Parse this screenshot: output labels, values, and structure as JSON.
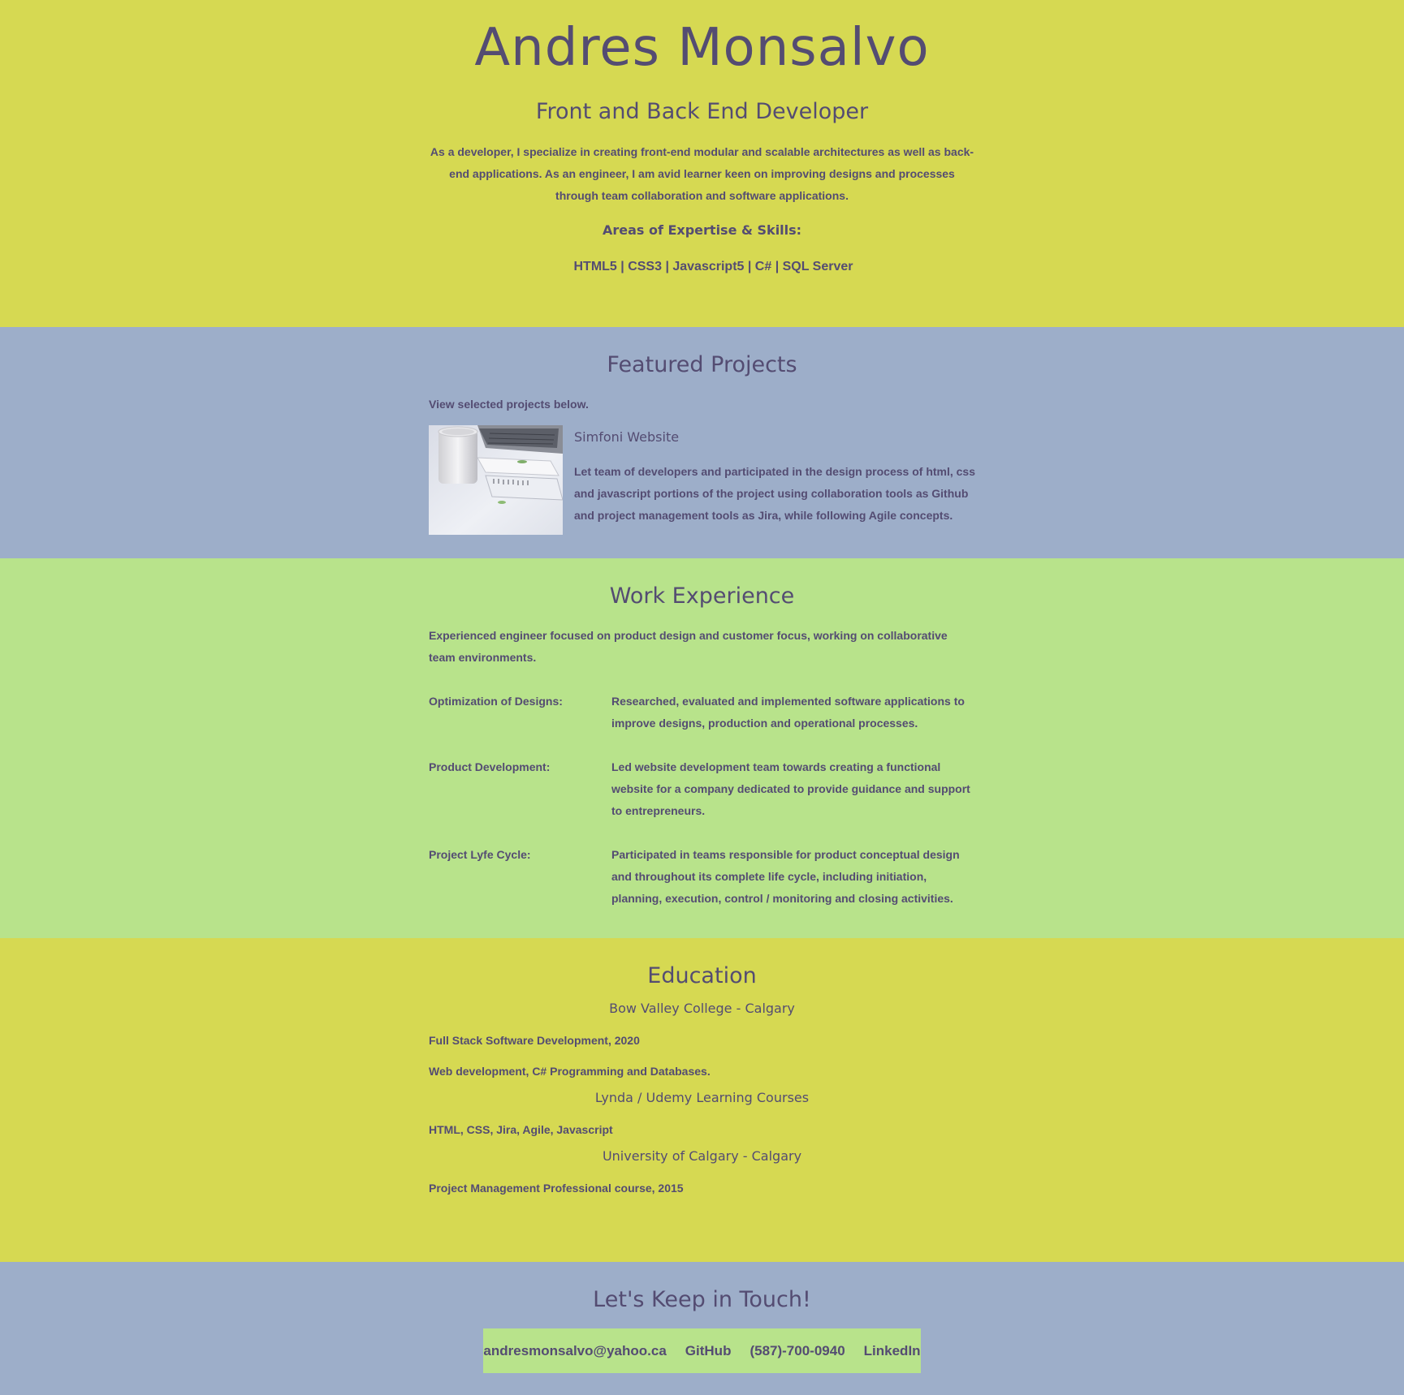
{
  "header": {
    "name": "Andres Monsalvo",
    "role": "Front and Back End Developer",
    "intro": "As a developer, I specialize in creating front-end modular and scalable architectures as well as back-end applications. As an engineer, I am avid learner keen on improving designs and processes through team collaboration and software applications.",
    "skills_heading": "Areas of Expertise & Skills:",
    "skills": "HTML5 | CSS3 | Javascript5 | C# | SQL Server"
  },
  "projects": {
    "title": "Featured Projects",
    "lead": "View selected projects below.",
    "items": [
      {
        "name": "Simfoni Website",
        "description": "Let team of developers and participated in the design process of html, css and javascript portions of the project using collaboration tools as Github and project management tools as Jira, while following Agile concepts."
      }
    ]
  },
  "work": {
    "title": "Work Experience",
    "lead": "Experienced engineer focused on product design and customer focus, working on collaborative team environments.",
    "items": [
      {
        "label": "Optimization of Designs:",
        "text": "Researched, evaluated and implemented software applications to improve designs, production and operational processes."
      },
      {
        "label": "Product Development:",
        "text": "Led website development team towards creating a functional website for a company dedicated to provide guidance and support to entrepreneurs."
      },
      {
        "label": "Project Lyfe Cycle:",
        "text": "Participated in teams responsible for product conceptual design and throughout its complete life cycle, including initiation, planning, execution, control / monitoring and closing activities."
      }
    ]
  },
  "education": {
    "title": "Education",
    "schools": [
      {
        "name": "Bow Valley College - Calgary",
        "lines": [
          "Full Stack Software Development, 2020",
          "Web development, C# Programming and Databases."
        ]
      },
      {
        "name": "Lynda / Udemy Learning Courses",
        "lines": [
          "HTML, CSS, Jira, Agile, Javascript"
        ]
      },
      {
        "name": "University of Calgary - Calgary",
        "lines": [
          "Project Management Professional course, 2015"
        ]
      }
    ]
  },
  "contact": {
    "title": "Let's Keep in Touch!",
    "email": "andresmonsalvo@yahoo.ca",
    "github": "GitHub",
    "phone": "(587)-700-0940",
    "linkedin": "LinkedIn"
  },
  "colors": {
    "yellow_band": "#d6d952",
    "blue_band": "#9daec9",
    "green_band": "#b8e38b",
    "text": "#544c72"
  }
}
